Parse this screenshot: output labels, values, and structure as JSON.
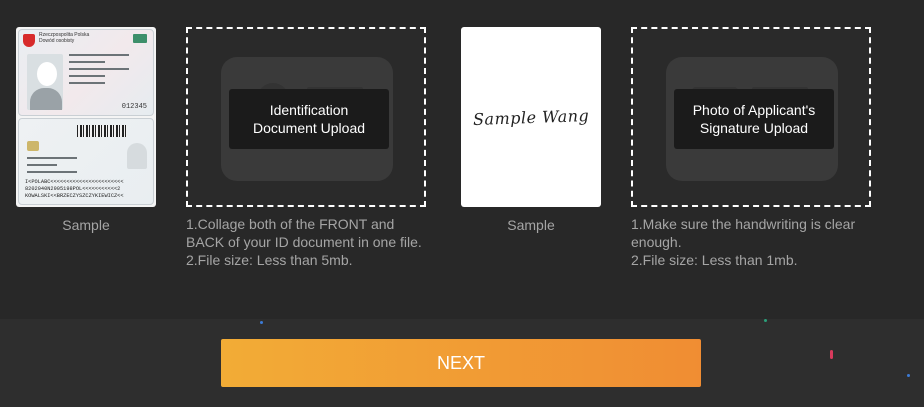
{
  "id_sample": {
    "caption": "Sample",
    "header_line1": "Rzeczpospolita Polska",
    "header_line2": "Dowód osobisty",
    "number": "012345",
    "mrz": [
      "I<POLABC<<<<<<<<<<<<<<<<<<<<<<<",
      "8202040N2905198POL<<<<<<<<<<<2",
      "KOWALSKI<<BRZECZYSZCZYKIEWICZ<<"
    ]
  },
  "id_upload": {
    "label_line1": "Identification",
    "label_line2": "Document Upload",
    "notes": [
      "1.Collage both of the FRONT and",
      "BACK of your ID document in one file.",
      "2.File size: Less than 5mb."
    ]
  },
  "signature_sample": {
    "signature_text": "Sample Wang",
    "caption": "Sample"
  },
  "signature_upload": {
    "label_line1": "Photo of Applicant's",
    "label_line2": "Signature Upload",
    "notes": [
      "1.Make sure the handwriting is clear",
      "enough.",
      "2.File size: Less than 1mb."
    ]
  },
  "footer": {
    "next_label": "NEXT"
  },
  "colors": {
    "background": "#282828",
    "button_start": "#f2ac36",
    "button_end": "#f08d33",
    "caption_text": "#a5a5a5"
  }
}
